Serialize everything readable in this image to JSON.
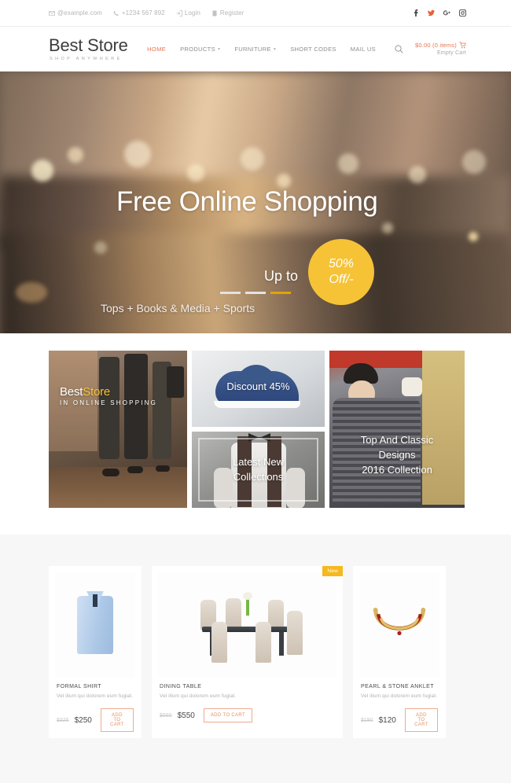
{
  "topbar": {
    "email": "@example.com",
    "phone": "+1234 567 892",
    "login": "Login",
    "register": "Register",
    "social": [
      {
        "name": "facebook-icon",
        "color": "#4b4b4b"
      },
      {
        "name": "twitter-icon",
        "color": "#e8613a"
      },
      {
        "name": "google-plus-icon",
        "color": "#4b4b4b"
      },
      {
        "name": "instagram-icon",
        "color": "#4b4b4b"
      }
    ]
  },
  "header": {
    "brand_name": "Best Store",
    "brand_tagline": "SHOP ANYWHERE",
    "nav": [
      {
        "label": "HOME",
        "active": true,
        "caret": ""
      },
      {
        "label": "PRODUCTS",
        "active": false,
        "caret": "▾"
      },
      {
        "label": "FURNITURE",
        "active": false,
        "caret": "▾"
      },
      {
        "label": "SHORT CODES",
        "active": false,
        "caret": ""
      },
      {
        "label": "MAIL US",
        "active": false,
        "caret": ""
      }
    ],
    "search_icon": "search-icon",
    "cart_total": "$0.00 (0 items)",
    "cart_status": "Empty Cart"
  },
  "hero": {
    "title": "Free Online Shopping",
    "upto": "Up to",
    "badge_line1": "50%",
    "badge_line2": "Off/-",
    "subtitle": "Tops + Books & Media + Sports",
    "slides": [
      {
        "active": false
      },
      {
        "active": false
      },
      {
        "active": true
      }
    ],
    "accent_color": "#f6c337"
  },
  "promos": [
    {
      "id": "promo-beststore",
      "line1_a": "Best",
      "line1_b": "Store",
      "line2": "IN ONLINE SHOPPING"
    },
    {
      "id": "promo-discount",
      "caption": "Discount 45%"
    },
    {
      "id": "promo-latest",
      "caption": "Latest New\nCollections"
    },
    {
      "id": "promo-classic",
      "caption": "Top And Classic\nDesigns\n2016 Collection"
    }
  ],
  "products": [
    {
      "name": "FORMAL SHIRT",
      "desc": "Vel illum qui dolorem eum fugiat.",
      "old_price": "$325",
      "new_price": "$250",
      "cta": "ADD TO CART",
      "badge": ""
    },
    {
      "name": "DINING TABLE",
      "desc": "Vel illum qui dolorem eum fugiat.",
      "old_price": "$660",
      "new_price": "$550",
      "cta": "ADD TO CART",
      "badge": "New"
    },
    {
      "name": "PEARL & STONE ANKLET",
      "desc": "Vel illum qui dolorem eum fugiat.",
      "old_price": "$180",
      "new_price": "$120",
      "cta": "ADD TO CART",
      "badge": ""
    }
  ]
}
